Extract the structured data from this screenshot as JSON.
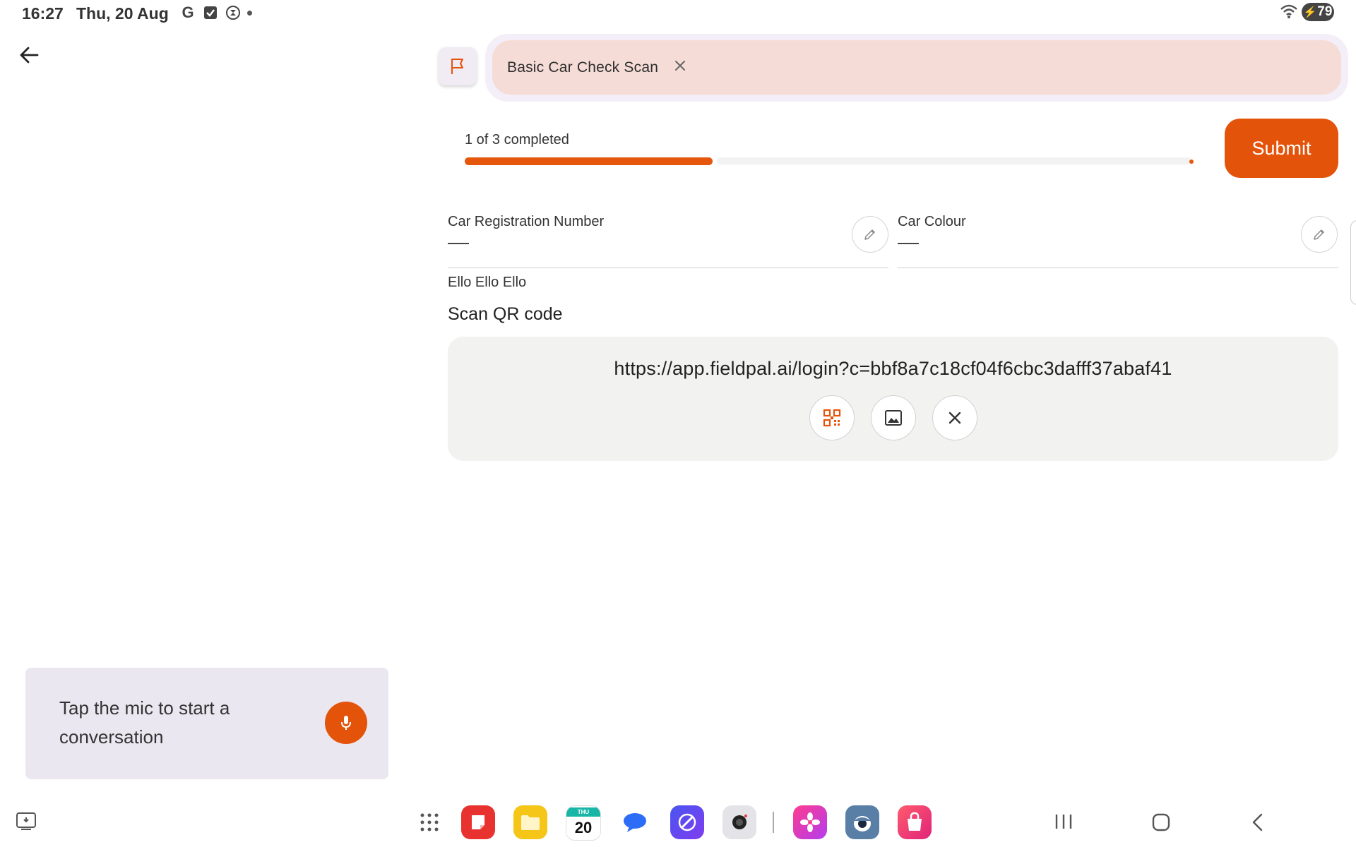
{
  "status_bar": {
    "time": "16:27",
    "date": "Thu, 20 Aug",
    "icons": [
      "google-icon",
      "tasks-check-icon",
      "digital-wellbeing-icon",
      "notification-dot"
    ],
    "battery": "79"
  },
  "header": {
    "chip_label": "Basic Car Check Scan"
  },
  "progress": {
    "text": "1 of 3 completed",
    "completed": 1,
    "total": 3,
    "fraction": 0.34
  },
  "submit_label": "Submit",
  "fields": [
    {
      "label": "Car Registration Number",
      "value": "—"
    },
    {
      "label": "Car Colour",
      "value": "—"
    }
  ],
  "sub_label": "Ello Ello Ello",
  "qr_section": {
    "title": "Scan QR code",
    "value": "https://app.fieldpal.ai/login?c=bbf8a7c18cf04f6cbc3dafff37abaf41"
  },
  "voice": {
    "prompt": "Tap the mic to start a conversation"
  },
  "taskbar": {
    "calendar_day": "THU",
    "calendar_date": "20",
    "apps": [
      "notes-app-icon",
      "files-app-icon",
      "calendar-app-icon",
      "messages-app-icon",
      "browser-app-icon",
      "camera-app-icon",
      "gallery-app-icon",
      "ai-app-icon",
      "store-app-icon"
    ]
  },
  "colors": {
    "accent": "#e4530a",
    "chip": "#f6dcd6",
    "voice_card": "#ebe7f0"
  }
}
